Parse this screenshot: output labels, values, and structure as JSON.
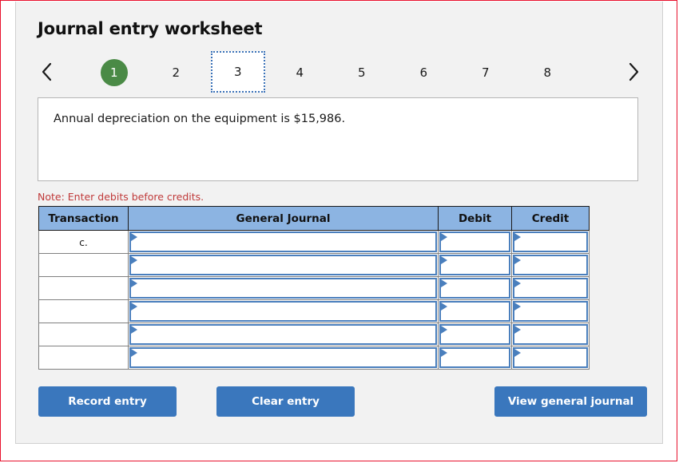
{
  "page": {
    "title": "Journal entry worksheet",
    "note": "Note: Enter debits before credits.",
    "prompt": "Annual depreciation on the equipment is $15,986.",
    "accent_blue": "#3a77bd",
    "header_blue": "#8cb4e2",
    "done_green": "#4a8a46",
    "note_red": "#c03a3a",
    "frame_red": "#e8112d"
  },
  "pager": {
    "prev_label": "previous",
    "next_label": "next",
    "items": [
      {
        "label": "1",
        "state": "done"
      },
      {
        "label": "2",
        "state": "normal"
      },
      {
        "label": "3",
        "state": "focused"
      },
      {
        "label": "4",
        "state": "normal"
      },
      {
        "label": "5",
        "state": "normal"
      },
      {
        "label": "6",
        "state": "normal"
      },
      {
        "label": "7",
        "state": "normal"
      },
      {
        "label": "8",
        "state": "normal"
      }
    ]
  },
  "table": {
    "headers": [
      "Transaction",
      "General Journal",
      "Debit",
      "Credit"
    ],
    "rows": [
      {
        "transaction": "c.",
        "general_journal": "",
        "debit": "",
        "credit": ""
      },
      {
        "transaction": "",
        "general_journal": "",
        "debit": "",
        "credit": ""
      },
      {
        "transaction": "",
        "general_journal": "",
        "debit": "",
        "credit": ""
      },
      {
        "transaction": "",
        "general_journal": "",
        "debit": "",
        "credit": ""
      },
      {
        "transaction": "",
        "general_journal": "",
        "debit": "",
        "credit": ""
      },
      {
        "transaction": "",
        "general_journal": "",
        "debit": "",
        "credit": ""
      }
    ]
  },
  "buttons": {
    "record": "Record entry",
    "clear": "Clear entry",
    "view": "View general journal"
  }
}
